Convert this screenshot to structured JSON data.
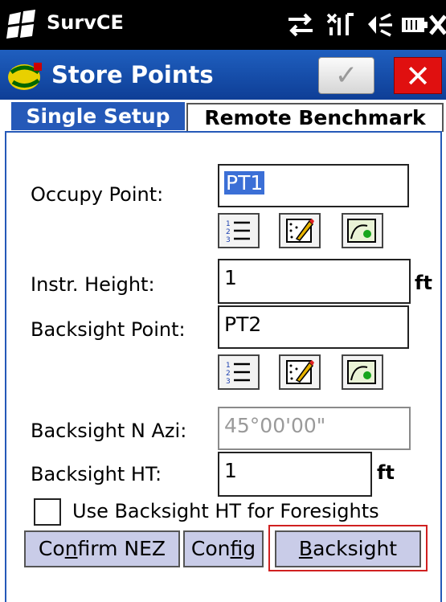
{
  "status_bar": {
    "app_name": "SurvCE",
    "icons": [
      "windows-flag-icon",
      "connectivity-icon",
      "no-signal-icon",
      "speaker-muted-icon",
      "battery-icon",
      "close-x-icon"
    ]
  },
  "title_bar": {
    "title": "Store Points",
    "ok_symbol": "✓",
    "close_symbol": "✕"
  },
  "tabs": [
    {
      "label": "Single Setup",
      "active": true
    },
    {
      "label": "Remote Benchmark",
      "active": false
    }
  ],
  "form": {
    "occupy_point": {
      "label": "Occupy Point:",
      "value": "PT1"
    },
    "instr_height": {
      "label": "Instr. Height:",
      "value": "1",
      "unit": "ft"
    },
    "backsight_point": {
      "label": "Backsight Point:",
      "value": "PT2"
    },
    "backsight_azi": {
      "label": "Backsight N Azi:",
      "value": "45°00'00\""
    },
    "backsight_ht": {
      "label": "Backsight HT:",
      "value": "1",
      "unit": "ft"
    },
    "use_backsight_ht": {
      "label": "Use Backsight HT for Foresights",
      "checked": false
    }
  },
  "buttons": {
    "confirm_pre": "Co",
    "confirm_ul": "n",
    "confirm_post": "firm NEZ",
    "config_pre": "Con",
    "config_ul": "f",
    "config_post": "ig",
    "backsight_ul": "B",
    "backsight_post": "acksight"
  },
  "colors": {
    "title_bar": "#1f5fbf",
    "active_tab": "#2559b8",
    "close_button": "#e01010",
    "button_bg": "#c9cce8",
    "highlight_border": "#d02020",
    "selected_text_bg": "#3b6fd6"
  }
}
